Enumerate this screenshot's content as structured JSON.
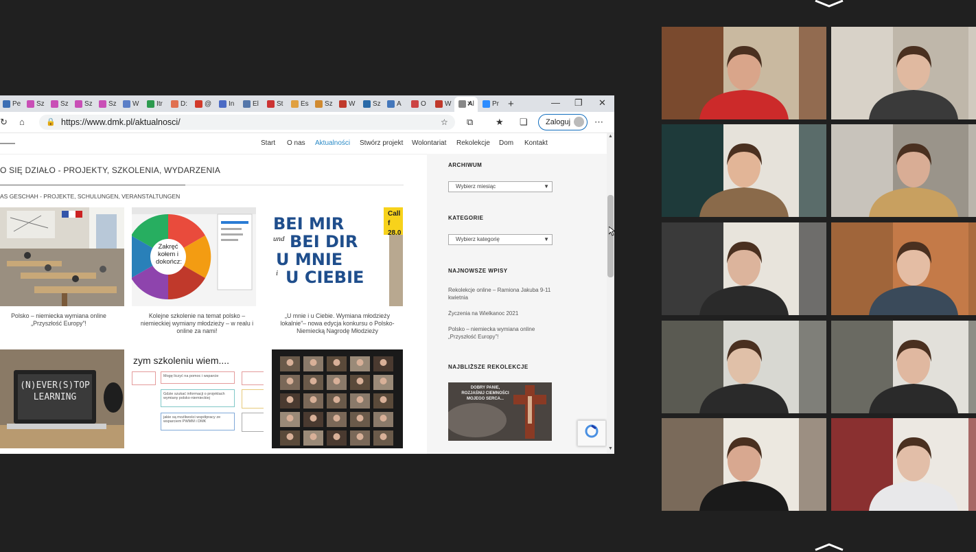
{
  "browser": {
    "tabs": [
      {
        "label": "Pe",
        "color": "#3d6fb4"
      },
      {
        "label": "Sz",
        "color": "#c94fb6"
      },
      {
        "label": "Sz",
        "color": "#c94fb6"
      },
      {
        "label": "Sz",
        "color": "#c94fb6"
      },
      {
        "label": "Sz",
        "color": "#c94fb6"
      },
      {
        "label": "W",
        "color": "#5b7fc7"
      },
      {
        "label": "Itr",
        "color": "#2c9a4e"
      },
      {
        "label": "D:",
        "color": "#e07050"
      },
      {
        "label": "@",
        "color": "#d23a2a"
      },
      {
        "label": "In",
        "color": "#4b6bc5"
      },
      {
        "label": "El",
        "color": "#5577aa"
      },
      {
        "label": "St",
        "color": "#cc3333"
      },
      {
        "label": "Es",
        "color": "#e0a040"
      },
      {
        "label": "Sz",
        "color": "#d08a30"
      },
      {
        "label": "W",
        "color": "#c0392b"
      },
      {
        "label": "Sz",
        "color": "#2a6aa8"
      },
      {
        "label": "A",
        "color": "#4477bb"
      },
      {
        "label": "O",
        "color": "#cc4444"
      },
      {
        "label": "W",
        "color": "#c0392b"
      },
      {
        "label": "Al",
        "color": "#888888"
      },
      {
        "label": "Pr",
        "color": "#2d8cff"
      }
    ],
    "url": "https://www.dmk.pl/aktualnosci/",
    "login_label": "Zaloguj"
  },
  "site": {
    "nav": [
      "Start",
      "O nas",
      "Aktualności",
      "Stwórz projekt",
      "Wolontariat",
      "Rekolekcje",
      "Dom",
      "Kontakt"
    ],
    "active_nav": "Aktualności",
    "heading": "O SIĘ DZIAŁO - PROJEKTY, SZKOLENIA, WYDARZENIA",
    "subheading": "AS GESCHAH - PROJEKTE, SCHULUNGEN, VERANSTALTUNGEN",
    "posts": [
      {
        "caption": [
          "Polsko – niemiecka wymiana online",
          "„Przyszłość Europy”!"
        ]
      },
      {
        "caption": [
          "Kolejne szkolenie na temat polsko –",
          "niemieckiej wymiany młodzieży – w realu i",
          "online za nami!"
        ]
      },
      {
        "caption": [
          "„U mnie i u Ciebie. Wymiana młodzieży",
          "lokalnie”– nowa edycja konkursu o Polsko-",
          "Niemiecką Nagrodę Młodzieży"
        ]
      }
    ],
    "wheel_text": "Zakręć kołem i dokończ:",
    "poster_lines": [
      "BEI MIR",
      "und",
      "BEI DIR",
      "U MNIE",
      "i",
      "U CIEBIE"
    ],
    "poster_corner": "Call f 28.0",
    "laptop_text": "(N)EVER(S)TOP LEARNING",
    "training_title": "zym szkoleniu wiem....",
    "training_boxes": [
      "Mogę liczyć na pomoc i wsparcie",
      "Gdzie szukać informacji o projektach wymiany polsko-niemieckiej",
      "jakie są możliwości współpracy ze wsparciem PWMM i DMK"
    ],
    "sidebar": {
      "archive_title": "ARCHIWUM",
      "archive_select": "Wybierz miesiąc",
      "categories_title": "KATEGORIE",
      "categories_select": "Wybierz kategorię",
      "latest_title": "NAJNOWSZE WPISY",
      "latest": [
        [
          "Rekolekcje online – Ramiona Jakuba 9-11",
          "kwietnia"
        ],
        [
          "Życzenia na Wielkanoc 2021"
        ],
        [
          "Polsko – niemiecka wymiana online",
          "„Przyszłość Europy”!"
        ]
      ],
      "retreat_title": "NAJBLIŻSZE REKOLEKCJE",
      "retreat_text": [
        "DOBRY PANIE,",
        "ROZJAŚNIJ CIEMNOŚCI",
        "MOJEGO SERCA..."
      ]
    }
  },
  "participants": [
    {
      "bg": "#7a4a2e",
      "wall": "#c9b9a0",
      "shirt": "#cc2a2a",
      "skin": "#d9a58a"
    },
    {
      "bg": "#d8d2c8",
      "wall": "#bfb7aa",
      "shirt": "#3a3a3a",
      "skin": "#e0b9a0"
    },
    {
      "bg": "#1e3a3a",
      "wall": "#e6e2da",
      "shirt": "#8a6a4a",
      "skin": "#e2b597"
    },
    {
      "bg": "#c8c3bb",
      "wall": "#9a948a",
      "shirt": "#c8a060",
      "skin": "#d9ad95"
    },
    {
      "bg": "#3a3a3a",
      "wall": "#e8e4dc",
      "shirt": "#2a2a2a",
      "skin": "#dcb49c"
    },
    {
      "bg": "#a0653a",
      "wall": "#c47a48",
      "shirt": "#3a4a5a",
      "skin": "#e4bda4"
    },
    {
      "bg": "#5a5a52",
      "wall": "#d8d8d2",
      "shirt": "#2a2a2a",
      "skin": "#e0c0a8"
    },
    {
      "bg": "#6a6a62",
      "wall": "#e2e0da",
      "shirt": "#2a2a2a",
      "skin": "#e0b8a0"
    },
    {
      "bg": "#7a6a5a",
      "wall": "#ece8e0",
      "shirt": "#1a1a1a",
      "skin": "#d8a890"
    },
    {
      "bg": "#8a3030",
      "wall": "#ece8e2",
      "shirt": "#e8e8ea",
      "skin": "#e2bea8"
    }
  ]
}
